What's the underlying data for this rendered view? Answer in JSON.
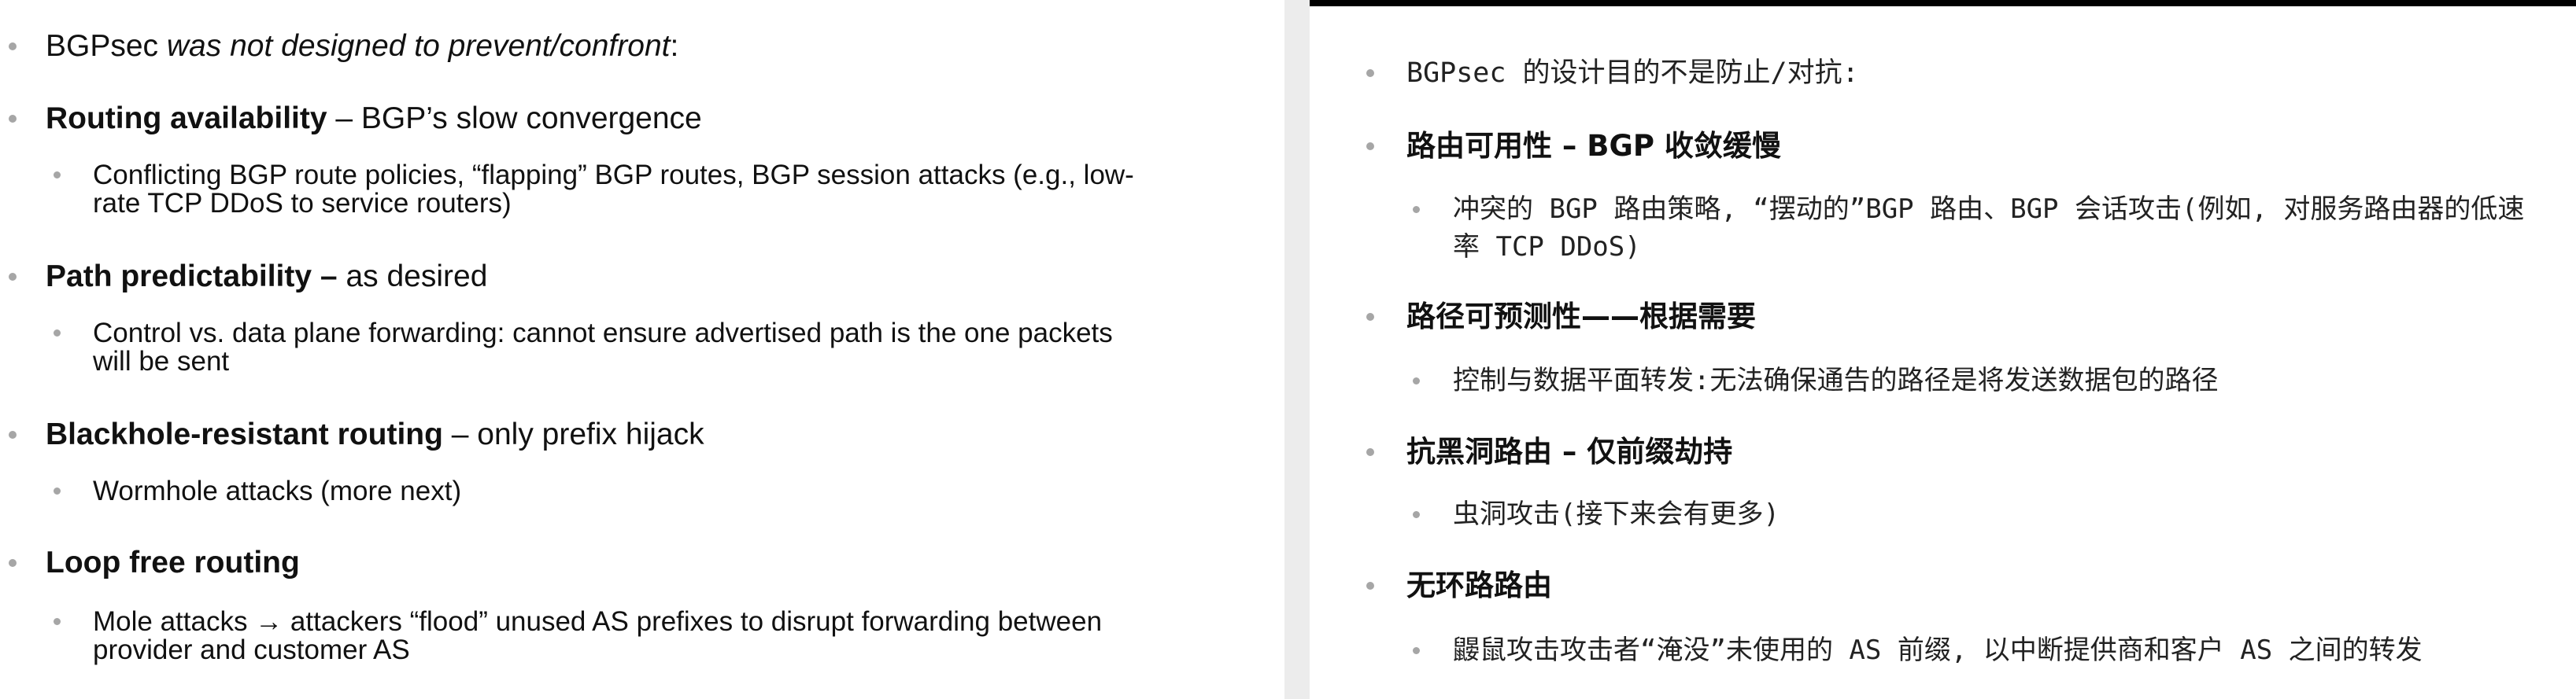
{
  "left": {
    "items": [
      {
        "bold": "",
        "rest": "BGPsec ",
        "italic": "was not designed to prevent/confront",
        "tail": ":"
      },
      {
        "bold": "Routing availability",
        "rest": " – BGP’s slow convergence"
      },
      {
        "line1": "Conflicting BGP route policies, “flapping” BGP routes, BGP session attacks (e.g., low-",
        "line2": "rate TCP DDoS to service routers)"
      },
      {
        "bold": "Path predictability –",
        "rest": " as desired"
      },
      {
        "line1": "Control vs. data plane forwarding: cannot ensure advertised path is the one packets",
        "line2": "will be sent"
      },
      {
        "bold": "Blackhole-resistant routing",
        "rest": " – only prefix hijack"
      },
      {
        "line1": "Wormhole attacks (more next)"
      },
      {
        "bold": "Loop free routing",
        "rest": ""
      },
      {
        "line1": "Mole attacks → attackers “flood” unused AS prefixes to disrupt forwarding between",
        "line2": "provider and customer AS"
      }
    ]
  },
  "right": {
    "items": [
      {
        "text": "BGPsec 的设计目的不是防止/对抗:"
      },
      {
        "text": "路由可用性 – BGP 收敛缓慢"
      },
      {
        "line1": "冲突的 BGP 路由策略, “摆动的”BGP 路由、BGP 会话攻击(例如, 对服务路由器的低速",
        "line2": "率 TCP DDoS)"
      },
      {
        "text": "路径可预测性——根据需要"
      },
      {
        "text": "控制与数据平面转发:无法确保通告的路径是将发送数据包的路径"
      },
      {
        "text": "抗黑洞路由 – 仅前缀劫持"
      },
      {
        "text": "虫洞攻击(接下来会有更多)"
      },
      {
        "text": "无环路路由"
      },
      {
        "text": "鼹鼠攻击攻击者“淹没”未使用的 AS 前缀, 以中断提供商和客户 AS 之间的转发"
      }
    ]
  },
  "colors": {
    "bullet": "#a6a6a6",
    "divider": "#ececec",
    "topbar": "#000000",
    "text": "#111111"
  }
}
